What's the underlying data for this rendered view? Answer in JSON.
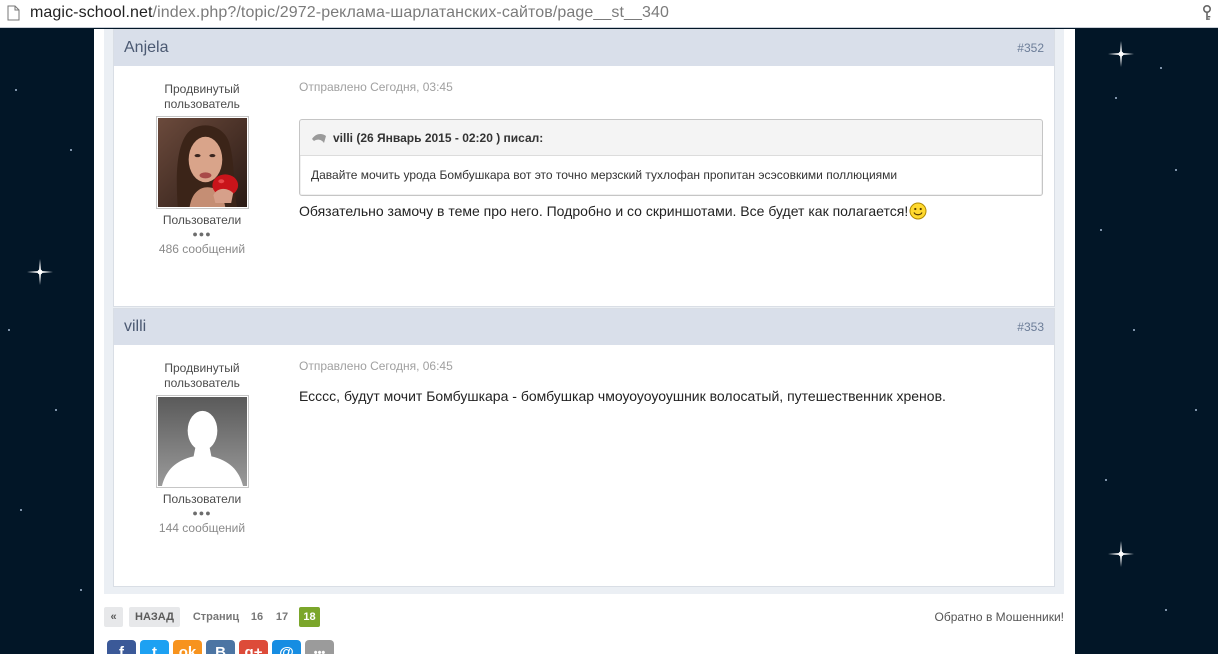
{
  "browser": {
    "url_host": "magic-school.net",
    "url_path": "/index.php?/topic/2972-реклама-шарлатанских-сайтов/page__st__340"
  },
  "posts": [
    {
      "author": "Anjela",
      "number": "#352",
      "rank": [
        "Продвинутый",
        "пользователь"
      ],
      "group": "Пользователи",
      "pips": "●●●",
      "message_count": "486 сообщений",
      "posted": "Отправлено Сегодня, 03:45",
      "quote": {
        "cite": "villi (26 Январь 2015 - 02:20 ) писал:",
        "text": "Давайте мочить урода Бомбушкара вот это точно мерзский тухлофан пропитан эсэсовкими поллюциями"
      },
      "text": "Обязательно замочу в теме про него. Подробно и со скриншотами. Все будет как полагается!"
    },
    {
      "author": "villi",
      "number": "#353",
      "rank": [
        "Продвинутый",
        "пользователь"
      ],
      "group": "Пользователи",
      "pips": "●●●",
      "message_count": "144 сообщений",
      "posted": "Отправлено Сегодня, 06:45",
      "text": "Ессcс, будут мочит Бомбушкара - бомбушкар чмоуоуоуоушник волосатый, путешественник хренов."
    }
  ],
  "pagination": {
    "first": "«",
    "back": "НАЗАД",
    "pages_label": "Страниц",
    "pages": [
      "16",
      "17"
    ],
    "current": "18"
  },
  "back_link": "Обратно в Мошенники!",
  "share_buttons": [
    {
      "label": "f",
      "icon": "facebook-icon",
      "color": "#3b5998"
    },
    {
      "label": "t",
      "icon": "twitter-icon",
      "color": "#1da1f2"
    },
    {
      "label": "ok",
      "icon": "odnoklassniki-icon",
      "color": "#f7931e"
    },
    {
      "label": "B",
      "icon": "vkontakte-icon",
      "color": "#4c75a3"
    },
    {
      "label": "g+",
      "icon": "google-plus-icon",
      "color": "#dd4b39"
    },
    {
      "label": "@",
      "icon": "mail-ru-icon",
      "color": "#168de2"
    },
    {
      "label": "•••",
      "icon": "more-icon",
      "color": "#9b9b9b"
    }
  ],
  "colors": {
    "accent_current_page": "#7ba62b",
    "post_header": "#d9dfea",
    "background": "#021627"
  }
}
